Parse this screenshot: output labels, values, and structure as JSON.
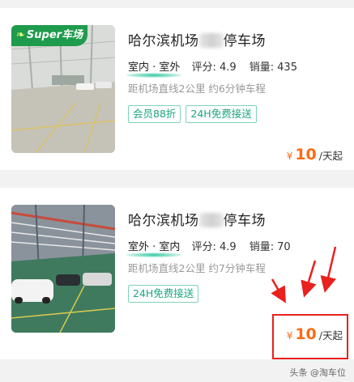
{
  "listings": [
    {
      "badge": "Super车场",
      "badge_brand": "Super",
      "badge_word": "车场",
      "title_prefix": "哈尔滨机场",
      "title_suffix": "停车场",
      "type": "室内 · 室外",
      "rating_label": "评分:",
      "rating": "4.9",
      "sales_label": "销量:",
      "sales": "435",
      "distance": "距机场直线2公里 约6分钟车程",
      "tags": [
        "会员88折",
        "24H免费接送"
      ],
      "price_currency": "¥",
      "price_value": "10",
      "price_unit": "/天起"
    },
    {
      "title_prefix": "哈尔滨机场",
      "title_suffix": "停车场",
      "type": "室外 · 室内",
      "rating_label": "评分:",
      "rating": "4.9",
      "sales_label": "销量:",
      "sales": "70",
      "distance": "距机场直线2公里 约7分钟车程",
      "tags": [
        "24H免费接送"
      ],
      "price_currency": "¥",
      "price_value": "10",
      "price_unit": "/天起"
    }
  ],
  "watermark": "头条 @淘车位",
  "colors": {
    "accent_orange": "#ff6a13",
    "tag_green": "#1ba57c",
    "badge_green": "#1e9b4c",
    "annotation_red": "#e8201e"
  }
}
